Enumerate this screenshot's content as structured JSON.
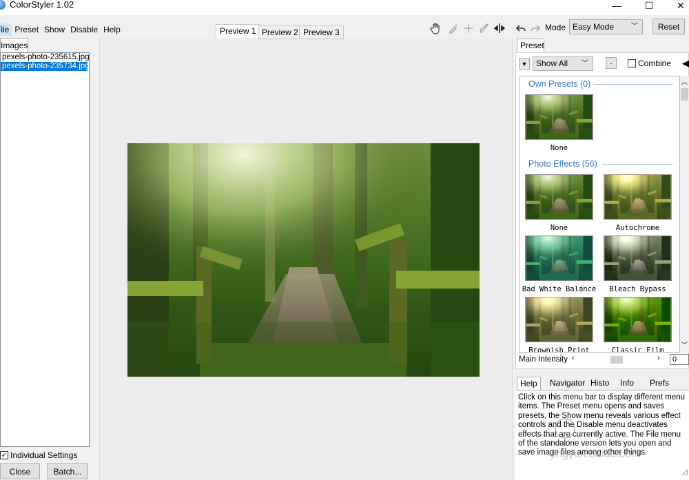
{
  "window": {
    "title": "ColorStyler 1.02",
    "minimize": "—",
    "maximize": "☐",
    "close": "✕"
  },
  "menu": [
    "File",
    "Preset",
    "Show",
    "Disable",
    "Help"
  ],
  "left_panel": {
    "tab": "Images",
    "files": [
      "pexels-photo-235615.jpg",
      "pexels-photo-235734.jpg"
    ],
    "selected_index": 1,
    "individual_settings_label": "Individual Settings",
    "individual_settings_checked": true,
    "close_label": "Close",
    "batch_label": "Batch..."
  },
  "preview_tabs": [
    "Preview 1",
    "Preview 2",
    "Preview 3"
  ],
  "active_preview": 0,
  "toolbar": {
    "tools": [
      "hand-icon",
      "eyedropper-icon",
      "crosshair-icon",
      "brush-icon",
      "split-arrows-icon"
    ],
    "undo_icon": "undo-icon",
    "redo_icon": "redo-icon",
    "mode_label": "Mode",
    "mode_value": "Easy Mode",
    "reset_label": "Reset"
  },
  "preset_panel": {
    "tab": "Preset",
    "filter_value": "Show All",
    "small_btn_label": "-",
    "combine_label": "Combine",
    "combine_checked": false,
    "sections": [
      {
        "title": "Own Presets (0)",
        "items": [
          "None"
        ]
      },
      {
        "title": "Photo Effects (56)",
        "items": [
          "None",
          "Autochrome",
          "Bad White Balance",
          "Bleach Bypass",
          "Brownish Print",
          "Classic Film"
        ]
      }
    ],
    "intensity_label": "Main Intensity",
    "intensity_value": "0"
  },
  "info_tabs": [
    "Help",
    "Navigator",
    "Histo",
    "Info",
    "Prefs"
  ],
  "active_info_tab": 0,
  "help_text": "Click on this menu bar to display different menu items. The Preset menu opens and saves presets, the Show menu reveals various effect controls and the Disable menu deactivates effects that are currently active. The File menu of the standalone version lets you open and save image files among other things.",
  "watermark": "jingyan.baidu.com"
}
